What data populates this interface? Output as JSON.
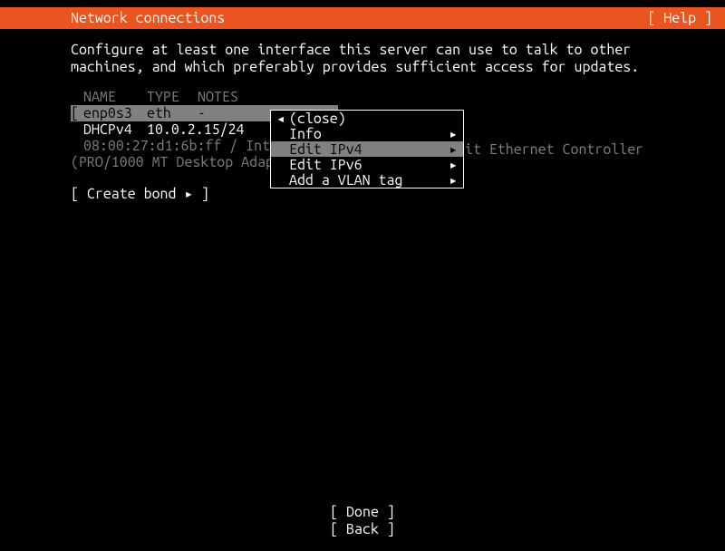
{
  "header": {
    "title": "Network connections",
    "help": "[ Help ]"
  },
  "instruction": "Configure at least one interface this server can use to talk to other machines, and which preferably provides sufficient access for updates.",
  "table": {
    "headers": {
      "name": "NAME",
      "type": "TYPE",
      "notes": "NOTES"
    },
    "iface": {
      "bracket_l": "[",
      "name": "enp0s3",
      "type": "eth",
      "notes": "-",
      "arrow": "▸"
    },
    "dhcp": {
      "label": "DHCPv4",
      "ip": "10.0.2.15/24"
    },
    "hw": "08:00:27:d1:6b:ff / Intel Corpor",
    "hw_tail": "it Ethernet Controller",
    "adapter": "(PRO/1000 MT Desktop Adapter)"
  },
  "create_bond": "[ Create bond ▸ ]",
  "popup": {
    "close_arrow": "◂",
    "close": "(close)",
    "info": "Info",
    "edit_ipv4": "Edit IPv4",
    "edit_ipv6": "Edit IPv6",
    "add_vlan": "Add a VLAN tag",
    "arrow": "▸"
  },
  "buttons": {
    "done": "[ Done       ]",
    "back": "[ Back       ]"
  }
}
